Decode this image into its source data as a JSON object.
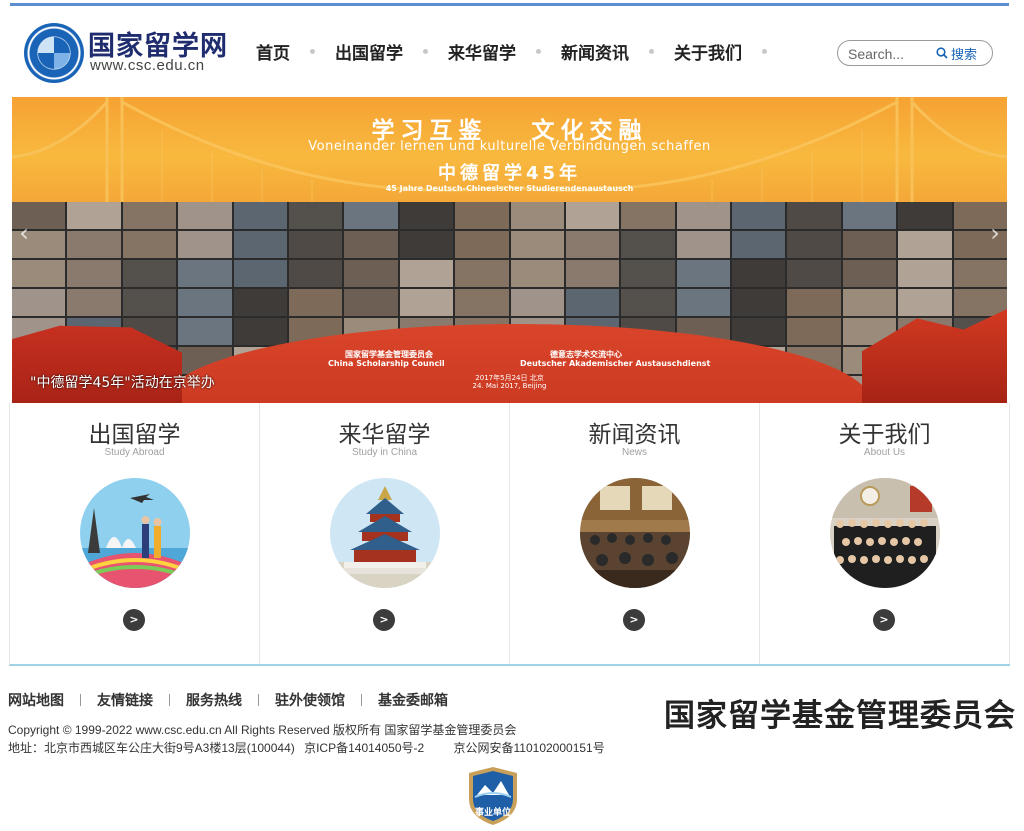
{
  "header": {
    "logo_text": "国家留学网",
    "logo_url": "www.csc.edu.cn",
    "nav": [
      {
        "label": "首页"
      },
      {
        "label": "出国留学"
      },
      {
        "label": "来华留学"
      },
      {
        "label": "新闻资讯"
      },
      {
        "label": "关于我们"
      }
    ],
    "search": {
      "placeholder": "Search...",
      "button_label": "搜索"
    }
  },
  "banner": {
    "title": "学习互鉴 文化交融",
    "subtitle": "Voneinander lernen und kulturelle Verbindungen schaffen",
    "title2": "中德留学45年",
    "subtitle2": "45 Jahre Deutsch-Chinesischer Studierendenaustausch",
    "org_cn_left": "国家留学基金管理委员会",
    "org_en_left": "China Scholarship Council",
    "org_cn_right": "德意志学术交流中心",
    "org_en_right": "Deutscher Akademischer Austauschdienst",
    "date_cn": "2017年5月24日 北京",
    "date_en": "24. Mai 2017, Beijing",
    "caption": "\"中德留学45年\"活动在京举办",
    "colors": {
      "sky": "#f8b93f",
      "arc": "#c6351f"
    }
  },
  "sections": [
    {
      "title": "出国留学",
      "subtitle": "Study Abroad",
      "image": "sydney-opera-house-eiffel-tower-couple-photo",
      "button_icon": "chevron-right-icon"
    },
    {
      "title": "来华留学",
      "subtitle": "Study in China",
      "image": "temple-of-heaven-photo",
      "button_icon": "chevron-right-icon"
    },
    {
      "title": "新闻资讯",
      "subtitle": "News",
      "image": "conference-room-photo",
      "button_icon": "chevron-right-icon"
    },
    {
      "title": "关于我们",
      "subtitle": "About Us",
      "image": "group-photo",
      "button_icon": "chevron-right-icon"
    }
  ],
  "footer": {
    "links": [
      {
        "label": "网站地图"
      },
      {
        "label": "友情链接"
      },
      {
        "label": "服务热线"
      },
      {
        "label": "驻外使领馆"
      },
      {
        "label": "基金委邮箱"
      }
    ],
    "copyright": "Copyright © 1999-2022 www.csc.edu.cn All Rights Reserved  版权所有  国家留学基金管理委员会",
    "address": "地址：北京市西城区车公庄大街9号A3楼13层(100044)",
    "icp": "京ICP备14014050号-2",
    "police": "京公网安备110102000151号",
    "org_logo": "国家留学基金管理委员会",
    "badge_label": "事业单位"
  },
  "colors": {
    "accent": "#1a64b8",
    "top_bar": "#5b8fd0",
    "divider": "#9fd2e3"
  }
}
